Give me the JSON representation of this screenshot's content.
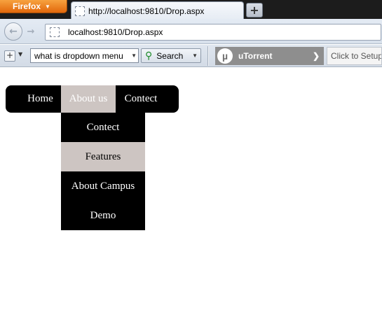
{
  "browser": {
    "app_button": "Firefox",
    "tab_title": "http://localhost:9810/Drop.aspx",
    "new_tab_glyph": "+",
    "url": "localhost:9810/Drop.aspx"
  },
  "toolbar": {
    "search_query": "what is dropdown menu",
    "search_button": "Search",
    "utorrent_label": "uTorrent",
    "setup_text": "Click to Setup"
  },
  "menu": {
    "items": [
      {
        "label": "Home"
      },
      {
        "label": "About us",
        "active": true
      },
      {
        "label": "Contect"
      }
    ],
    "submenu": [
      {
        "label": "Contect"
      },
      {
        "label": "Features",
        "hover": true
      },
      {
        "label": "About Campus"
      },
      {
        "label": "Demo"
      }
    ]
  },
  "colors": {
    "menu_bg": "#000000",
    "active_bg": "#cdc5c2",
    "firefox_orange": "#e2670b",
    "utorrent_gray": "#8e8e8e"
  }
}
